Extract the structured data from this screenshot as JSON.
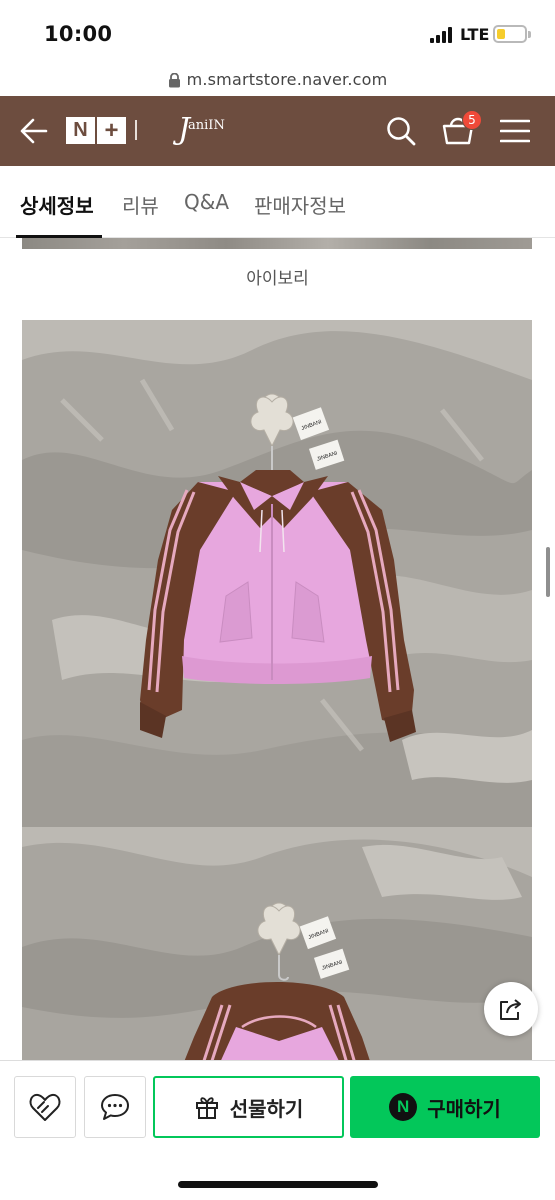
{
  "status_bar": {
    "time": "10:00",
    "network": "LTE",
    "battery_color": "#f6cd2c"
  },
  "browser": {
    "url": "m.smartstore.naver.com"
  },
  "header": {
    "background": "#6d4d3f",
    "nplus_n": "N",
    "nplus_plus": "+",
    "brand_big": "J",
    "brand_small": "aniIN",
    "cart_count": "5",
    "icons": [
      "back-arrow-icon",
      "search-icon",
      "cart-icon",
      "menu-icon"
    ]
  },
  "tabs": [
    {
      "label": "상세정보",
      "active": true
    },
    {
      "label": "리뷰",
      "active": false
    },
    {
      "label": "Q&A",
      "active": false
    },
    {
      "label": "판매자정보",
      "active": false
    }
  ],
  "content": {
    "color_label": "아이보리",
    "tag_text": "JINBANI",
    "jacket_colors": {
      "body": "#e7a7de",
      "sleeve": "#6a3d2a",
      "stripe": "#e6a9bf"
    }
  },
  "bottom_bar": {
    "gift_label": "선물하기",
    "buy_label": "구매하기",
    "npay_letter": "N",
    "accent": "#03c75a"
  }
}
